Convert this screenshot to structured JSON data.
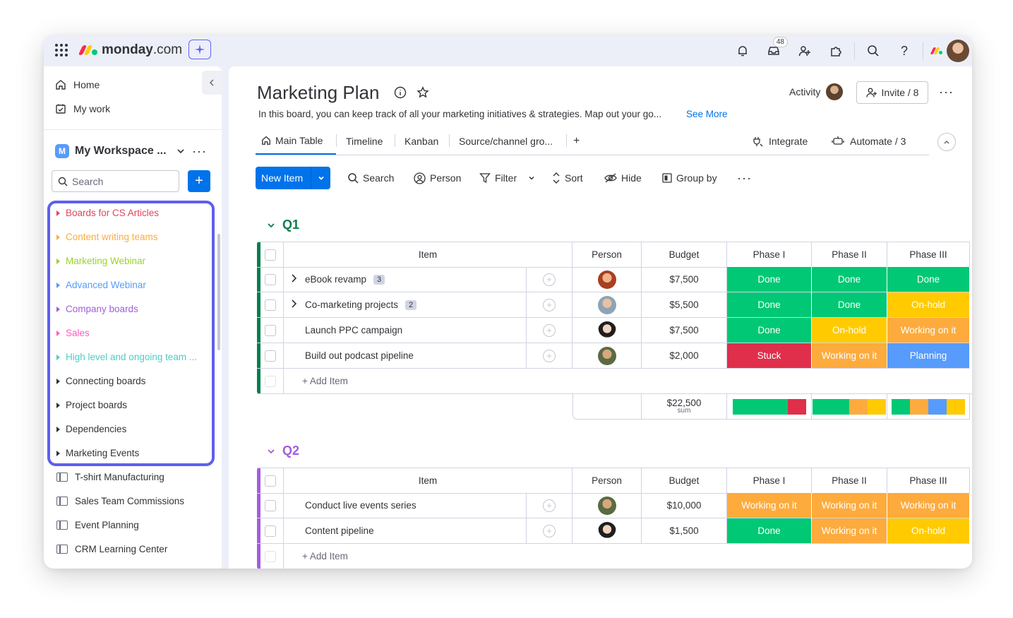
{
  "topbar": {
    "brand": "monday",
    "brand_suffix": ".com",
    "inbox_count": "48",
    "icons": [
      "apps-grid-icon",
      "ai-sparkle-icon",
      "bell-icon",
      "inbox-icon",
      "invite-person-icon",
      "integrations-puzzle-icon",
      "search-icon",
      "help-icon"
    ]
  },
  "sidebar": {
    "home": "Home",
    "my_work": "My work",
    "workspace": {
      "badge": "M",
      "name": "My Workspace ...",
      "more": "···"
    },
    "search_placeholder": "Search",
    "add": "+",
    "folders": [
      {
        "label": "Boards for CS Articles",
        "color": "#e2445c"
      },
      {
        "label": "Content writing teams",
        "color": "#fdab3d"
      },
      {
        "label": "Marketing Webinar",
        "color": "#9cd326"
      },
      {
        "label": "Advanced Webinar",
        "color": "#579bfc"
      },
      {
        "label": "Company boards",
        "color": "#a25ddc"
      },
      {
        "label": "Sales",
        "color": "#ff5ac4"
      },
      {
        "label": "High level and ongoing team ...",
        "color": "#4eccc6"
      },
      {
        "label": "Connecting boards",
        "color": "#323338"
      },
      {
        "label": "Project boards",
        "color": "#323338"
      },
      {
        "label": "Dependencies",
        "color": "#323338"
      },
      {
        "label": "Marketing Events",
        "color": "#323338"
      }
    ],
    "boards": [
      {
        "label": "T-shirt Manufacturing"
      },
      {
        "label": "Sales Team Commissions"
      },
      {
        "label": "Event Planning"
      },
      {
        "label": "CRM Learning Center"
      }
    ],
    "highlight_color": "#5d5fef"
  },
  "board": {
    "title": "Marketing Plan",
    "description": "In this board, you can keep track of all your marketing initiatives & strategies. Map out your go...",
    "see_more": "See More",
    "activity": "Activity",
    "invite": "Invite / 8",
    "more": "···",
    "tabs": [
      "Main Table",
      "Timeline",
      "Kanban",
      "Source/channel gro...",
      "+"
    ],
    "integrate": "Integrate",
    "automate": "Automate / 3",
    "toolbar": {
      "new_item": "New Item",
      "search": "Search",
      "person": "Person",
      "filter": "Filter",
      "sort": "Sort",
      "hide": "Hide",
      "group_by": "Group by",
      "more": "···"
    },
    "columns": [
      "Item",
      "Person",
      "Budget",
      "Phase I",
      "Phase II",
      "Phase III"
    ],
    "add_item": "+ Add Item"
  },
  "status_colors": {
    "Done": "#00c875",
    "On-hold": "#ffcb00",
    "Working on it": "#fdab3d",
    "Stuck": "#df2f4a",
    "Planning": "#579bfc"
  },
  "groups": [
    {
      "name": "Q1",
      "color": "#037f4c",
      "items": [
        {
          "name": "eBook revamp",
          "count": "3",
          "expand": true,
          "budget": "$7,500",
          "phases": [
            "Done",
            "Done",
            "Done"
          ]
        },
        {
          "name": "Co-marketing projects",
          "count": "2",
          "expand": true,
          "budget": "$5,500",
          "phases": [
            "Done",
            "Done",
            "On-hold"
          ]
        },
        {
          "name": "Launch PPC campaign",
          "count": "",
          "expand": false,
          "budget": "$7,500",
          "phases": [
            "Done",
            "On-hold",
            "Working on it"
          ]
        },
        {
          "name": "Build out podcast pipeline",
          "count": "",
          "expand": false,
          "budget": "$2,000",
          "phases": [
            "Stuck",
            "Working on it",
            "Planning"
          ]
        }
      ],
      "summary": {
        "budget": "$22,500",
        "budget_label": "sum",
        "phase_bars": [
          [
            {
              "status": "Done",
              "share": 0.75
            },
            {
              "status": "Stuck",
              "share": 0.25
            }
          ],
          [
            {
              "status": "Done",
              "share": 0.5
            },
            {
              "status": "Working on it",
              "share": 0.25
            },
            {
              "status": "On-hold",
              "share": 0.25
            }
          ],
          [
            {
              "status": "Done",
              "share": 0.25
            },
            {
              "status": "Working on it",
              "share": 0.25
            },
            {
              "status": "Planning",
              "share": 0.25
            },
            {
              "status": "On-hold",
              "share": 0.25
            }
          ]
        ]
      }
    },
    {
      "name": "Q2",
      "color": "#a25ddc",
      "items": [
        {
          "name": "Conduct live events series",
          "count": "",
          "expand": false,
          "budget": "$10,000",
          "phases": [
            "Working on it",
            "Working on it",
            "Working on it"
          ]
        },
        {
          "name": "Content pipeline",
          "count": "",
          "expand": false,
          "budget": "$1,500",
          "phases": [
            "Done",
            "Working on it",
            "On-hold"
          ]
        }
      ]
    }
  ]
}
